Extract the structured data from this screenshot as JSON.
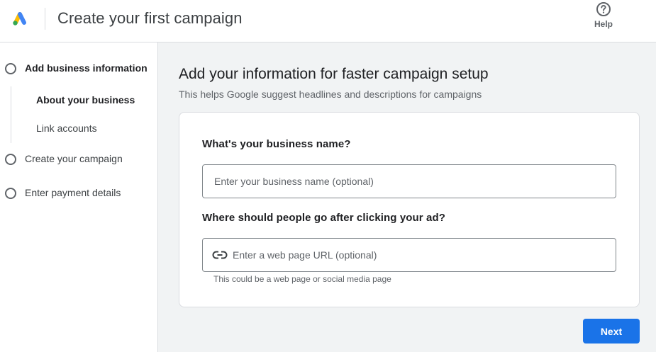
{
  "header": {
    "title": "Create your first campaign",
    "help_label": "Help",
    "logo_icon": "google-ads-logo",
    "help_icon": "help-circle-icon"
  },
  "sidebar": {
    "steps": [
      {
        "label": "Add business information",
        "active": true
      },
      {
        "label": "Create your campaign",
        "active": false
      },
      {
        "label": "Enter payment details",
        "active": false
      }
    ],
    "substeps": [
      {
        "label": "About your business",
        "active": true
      },
      {
        "label": "Link accounts",
        "active": false
      }
    ]
  },
  "main": {
    "heading": "Add your information for faster campaign setup",
    "subheading": "This helps Google suggest headlines and descriptions for campaigns",
    "form": {
      "business_name_label": "What's your business name?",
      "business_name_placeholder": "Enter your business name (optional)",
      "url_label": "Where should people go after clicking your ad?",
      "url_placeholder": "Enter a web page URL (optional)",
      "url_icon": "link-icon",
      "url_hint": "This could be a web page or social media page"
    },
    "next_label": "Next"
  },
  "colors": {
    "primary": "#1a73e8",
    "ads_blue": "#4285f4",
    "ads_yellow": "#fbbc04",
    "ads_green": "#34a853"
  }
}
